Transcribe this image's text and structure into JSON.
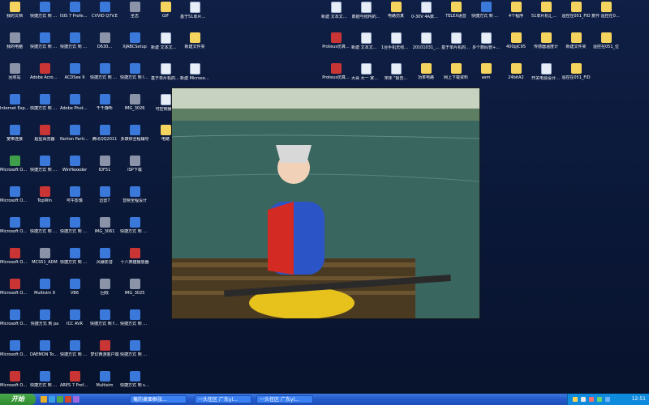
{
  "left_icons": [
    {
      "label": "我的文档",
      "icon": "my-documents-icon",
      "type": "folder"
    },
    {
      "label": "快捷方式 到 25i1IF",
      "icon": "shortcut-icon",
      "type": "exe"
    },
    {
      "label": "ISIS 7 Professional",
      "icon": "isis-icon",
      "type": "exe"
    },
    {
      "label": "CVVID Q7V.E",
      "icon": "video-icon",
      "type": "exe"
    },
    {
      "label": "圣志",
      "icon": "app-icon",
      "type": "gray"
    },
    {
      "label": "我的电脑",
      "icon": "my-computer-icon",
      "type": "gray"
    },
    {
      "label": "快捷方式 到 MSI控制器",
      "icon": "shortcut-icon",
      "type": "exe"
    },
    {
      "label": "快捷方式 到 Keil...",
      "icon": "shortcut-icon",
      "type": "exe"
    },
    {
      "label": "D630...",
      "icon": "app-icon",
      "type": "gray"
    },
    {
      "label": "XJABCSetup",
      "icon": "setup-icon",
      "type": "exe"
    },
    {
      "label": "回收站",
      "icon": "recycle-bin-icon",
      "type": "gray"
    },
    {
      "label": "Adobe Acrobat 7",
      "icon": "acrobat-icon",
      "type": "red"
    },
    {
      "label": "ACDSee 9",
      "icon": "acdsee-icon",
      "type": "exe"
    },
    {
      "label": "快捷方式 到 windowspt",
      "icon": "shortcut-icon",
      "type": "exe"
    },
    {
      "label": "快捷方式 到 ISDKJ",
      "icon": "shortcut-icon",
      "type": "exe"
    },
    {
      "label": "Internet Explorer",
      "icon": "ie-icon",
      "type": "exe"
    },
    {
      "label": "快捷方式 到 STC_ISP_V480",
      "icon": "shortcut-icon",
      "type": "exe"
    },
    {
      "label": "Adobe Photo...",
      "icon": "photoshop-icon",
      "type": "exe"
    },
    {
      "label": "千千静听",
      "icon": "ttplayer-icon",
      "type": "exe"
    },
    {
      "label": "IMG_3026",
      "icon": "image-icon",
      "type": "gray"
    },
    {
      "label": "宽带连接",
      "icon": "broadband-icon",
      "type": "exe"
    },
    {
      "label": "超星阅览器",
      "icon": "ssreader-icon",
      "type": "red"
    },
    {
      "label": "Norton PartitionM...",
      "icon": "norton-icon",
      "type": "exe"
    },
    {
      "label": "腾讯QQ2011",
      "icon": "qq-icon",
      "type": "exe"
    },
    {
      "label": "多媒体全程辅导",
      "icon": "media-icon",
      "type": "exe"
    },
    {
      "label": "Microsoft Office E...",
      "icon": "excel-icon",
      "type": "green"
    },
    {
      "label": "快捷方式 到 Uv3",
      "icon": "shortcut-icon",
      "type": "exe"
    },
    {
      "label": "WinHexeder",
      "icon": "winhex-icon",
      "type": "exe"
    },
    {
      "label": "IDF51",
      "icon": "app-icon",
      "type": "gray"
    },
    {
      "label": "ISP下载",
      "icon": "app-icon",
      "type": "gray"
    },
    {
      "label": "Microsoft Office Ou...",
      "icon": "outlook-icon",
      "type": "exe"
    },
    {
      "label": "TopWin",
      "icon": "topwin-icon",
      "type": "red"
    },
    {
      "label": "可牛影像",
      "icon": "image-editor-icon",
      "type": "exe"
    },
    {
      "label": "迅雷7",
      "icon": "thunder-icon",
      "type": "exe"
    },
    {
      "label": "音频全程设计",
      "icon": "audio-icon",
      "type": "exe"
    },
    {
      "label": "Microsoft Office...",
      "icon": "word-icon",
      "type": "exe"
    },
    {
      "label": "快捷方式 到 EMPlayer",
      "icon": "shortcut-icon",
      "type": "exe"
    },
    {
      "label": "快捷方式 到 SolidWorks",
      "icon": "shortcut-icon",
      "type": "exe"
    },
    {
      "label": "IMG_3061",
      "icon": "image-icon",
      "type": "gray"
    },
    {
      "label": "快捷方式 到 VdB",
      "icon": "shortcut-icon",
      "type": "exe"
    },
    {
      "label": "Microsoft Office...",
      "icon": "powerpoint-icon",
      "type": "red"
    },
    {
      "label": "MCS51_ADM",
      "icon": "app-icon",
      "type": "gray"
    },
    {
      "label": "快捷方式 到 win32",
      "icon": "shortcut-icon",
      "type": "exe"
    },
    {
      "label": "风暴影音",
      "icon": "player-icon",
      "type": "exe"
    },
    {
      "label": "十八英雄播放器",
      "icon": "player-icon",
      "type": "red"
    },
    {
      "label": "Microsoft Office...",
      "icon": "access-icon",
      "type": "red"
    },
    {
      "label": "Multisim 9",
      "icon": "multisim-icon",
      "type": "exe"
    },
    {
      "label": "VB6",
      "icon": "vb6-icon",
      "type": "exe"
    },
    {
      "label": "回收",
      "icon": "app-icon",
      "type": "gray"
    },
    {
      "label": "IMG_3025",
      "icon": "image-icon",
      "type": "gray"
    },
    {
      "label": "Microsoft Office Vi...",
      "icon": "visio-icon",
      "type": "exe"
    },
    {
      "label": "快捷方式 到 pa",
      "icon": "shortcut-icon",
      "type": "exe"
    },
    {
      "label": "ICC AVR",
      "icon": "iccavr-icon",
      "type": "exe"
    },
    {
      "label": "快捷方式 到 feedingSo...",
      "icon": "shortcut-icon",
      "type": "exe"
    },
    {
      "label": "快捷方式 到 Cn5",
      "icon": "shortcut-icon",
      "type": "exe"
    },
    {
      "label": "Microsoft Office W...",
      "icon": "word-icon",
      "type": "exe"
    },
    {
      "label": "DAEMON Tools",
      "icon": "daemon-icon",
      "type": "exe"
    },
    {
      "label": "快捷方式 到 单片机...",
      "icon": "shortcut-icon",
      "type": "exe"
    },
    {
      "label": "梦幻西游客户端",
      "icon": "game-icon",
      "type": "red"
    },
    {
      "label": "快捷方式 到 声卡...",
      "icon": "shortcut-icon",
      "type": "exe"
    },
    {
      "label": "Microsoft Office...",
      "icon": "office-icon",
      "type": "red"
    },
    {
      "label": "快捷方式 到 progisp",
      "icon": "shortcut-icon",
      "type": "exe"
    },
    {
      "label": "ARES 7 Professional",
      "icon": "ares-icon",
      "type": "red"
    },
    {
      "label": "Multisim",
      "icon": "multisim-icon",
      "type": "exe"
    },
    {
      "label": "快捷方式 到 sedtest",
      "icon": "shortcut-icon",
      "type": "exe"
    }
  ],
  "mid_icons": [
    {
      "label": "GIF",
      "type": "folder"
    },
    {
      "label": "基于51单片机...",
      "type": "doc"
    },
    {
      "label": "新建 文本文档 (2)",
      "type": "doc"
    },
    {
      "label": "新建文件夹",
      "type": "folder"
    },
    {
      "label": "基于单片机的温度...",
      "type": "doc"
    },
    {
      "label": "新建 Microsoft...",
      "type": "doc"
    },
    {
      "label": "可控制播放",
      "type": "doc"
    },
    {
      "label": "放大数据录像",
      "type": "folder"
    },
    {
      "label": "电路",
      "type": "folder"
    },
    {
      "label": "7X1F",
      "type": "folder"
    }
  ],
  "right_icons": [
    {
      "label": "新建 文本文档 (12)",
      "type": "doc"
    },
    {
      "label": "数据与结构的...",
      "type": "doc"
    },
    {
      "label": "电路仿真",
      "type": "folder"
    },
    {
      "label": "0-30V 4A数控稳压电源...",
      "type": "doc"
    },
    {
      "label": "TELEX语音",
      "type": "folder"
    },
    {
      "label": "快捷方式 到 051",
      "type": "exe"
    },
    {
      "label": "4个程序",
      "type": "folder"
    },
    {
      "label": "51单片机汇编语言教程",
      "type": "folder"
    },
    {
      "label": "遥控在051_FID",
      "type": "folder"
    },
    {
      "label": "复件 遥控在051_FID",
      "type": "folder"
    },
    {
      "label": "Proteus仿真...",
      "type": "red"
    },
    {
      "label": "新建 文本文档 (4)",
      "type": "doc"
    },
    {
      "label": "1台手机无线电...",
      "type": "doc"
    },
    {
      "label": "20101031_...",
      "type": "doc"
    },
    {
      "label": "基于单片机的电子...",
      "type": "doc"
    },
    {
      "label": "多个数码管+...",
      "type": "doc"
    },
    {
      "label": "400pJC95",
      "type": "folder"
    },
    {
      "label": "传感器温度计",
      "type": "folder"
    },
    {
      "label": "新建文件夹",
      "type": "folder"
    },
    {
      "label": "遥控在051_位",
      "type": "folder"
    },
    {
      "label": "Proteus仿真...",
      "type": "red"
    },
    {
      "label": "大哥 大一 家庭...",
      "type": "doc"
    },
    {
      "label": "宋体 \"报告...",
      "type": "doc"
    },
    {
      "label": "功率电路",
      "type": "folder"
    },
    {
      "label": "网上下载资料",
      "type": "folder"
    },
    {
      "label": "asm",
      "type": "folder"
    },
    {
      "label": "24bitA2",
      "type": "folder"
    },
    {
      "label": "开关电源设计一般考虑...",
      "type": "doc"
    },
    {
      "label": "遥控在051_FID",
      "type": "folder"
    }
  ],
  "photo": {
    "description_alt": "portrait"
  },
  "taskbar": {
    "start_label": "开始",
    "tasks": [
      "俺的桌面框张...",
      "一头任区 广东yl...",
      "一头任区 广东yl..."
    ],
    "clock": "12:51"
  }
}
